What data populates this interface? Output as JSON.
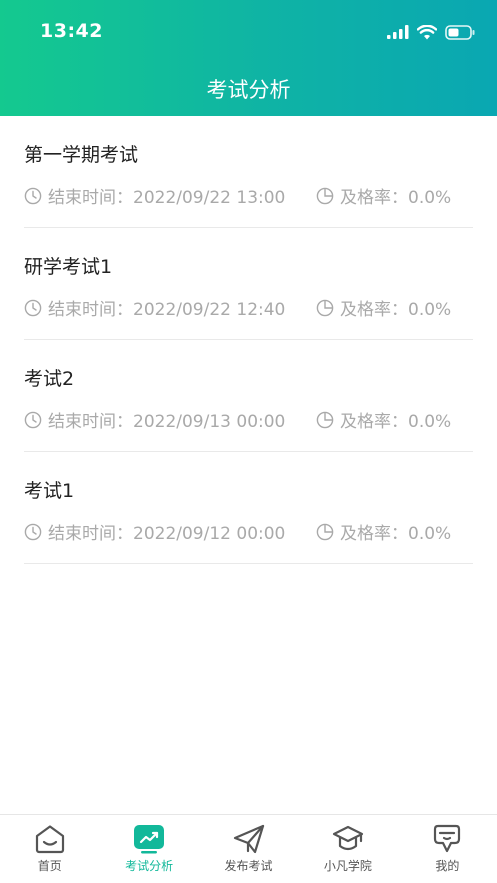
{
  "status": {
    "time": "13:42"
  },
  "header": {
    "title": "考试分析"
  },
  "exams": [
    {
      "title": "第一学期考试",
      "end_label": "结束时间：",
      "end_time": "2022/09/22 13:00",
      "rate_label": "及格率：",
      "rate": "0.0%"
    },
    {
      "title": "研学考试1",
      "end_label": "结束时间：",
      "end_time": "2022/09/22 12:40",
      "rate_label": "及格率：",
      "rate": "0.0%"
    },
    {
      "title": "考试2",
      "end_label": "结束时间：",
      "end_time": "2022/09/13 00:00",
      "rate_label": "及格率：",
      "rate": "0.0%"
    },
    {
      "title": "考试1",
      "end_label": "结束时间：",
      "end_time": "2022/09/12 00:00",
      "rate_label": "及格率：",
      "rate": "0.0%"
    }
  ],
  "tabbar": {
    "items": [
      {
        "label": "首页",
        "icon": "home-icon",
        "active": false
      },
      {
        "label": "考试分析",
        "icon": "analysis-icon",
        "active": true
      },
      {
        "label": "发布考试",
        "icon": "paper-plane-icon",
        "active": false
      },
      {
        "label": "小凡学院",
        "icon": "graduation-cap-icon",
        "active": false
      },
      {
        "label": "我的",
        "icon": "profile-icon",
        "active": false
      }
    ]
  },
  "colors": {
    "accent": "#12b89a",
    "header_start": "#14c98f",
    "header_end": "#0aa7b2",
    "meta_text": "#a9a9a9"
  }
}
